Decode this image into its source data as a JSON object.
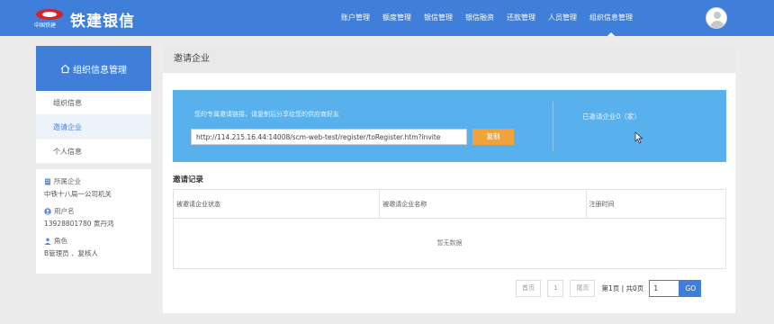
{
  "header": {
    "logo_sub": "中国铁建",
    "brand": "铁建银信",
    "nav": [
      {
        "label": "账户管理"
      },
      {
        "label": "额度管理"
      },
      {
        "label": "银信管理"
      },
      {
        "label": "银信融资"
      },
      {
        "label": "还款管理"
      },
      {
        "label": "人员管理"
      },
      {
        "label": "组织信息管理"
      }
    ]
  },
  "sidebar": {
    "title": "组织信息管理",
    "items": [
      {
        "label": "组织信息"
      },
      {
        "label": "邀请企业"
      },
      {
        "label": "个人信息"
      }
    ],
    "info": {
      "company_label": "所属企业",
      "company_value": "中铁十八局一公司机关",
      "user_label": "用户名",
      "user_value": "13928801780 黄丹鸿",
      "role_label": "角色",
      "role_value": "B管理员 、复核人"
    }
  },
  "main": {
    "title": "邀请企业",
    "banner": {
      "text": "您的专属邀请链接，请复制后分享给您的供应商好友",
      "link": "http://114.215.16.44:14008/scm-web-test/register/toRegister.htm?invite",
      "copy_label": "复制",
      "invited_count": "已邀请企业0（家）"
    },
    "records_title": "邀请记录",
    "table": {
      "columns": [
        "被邀请企业状态",
        "被邀请企业名称",
        "注册时间"
      ],
      "empty_text": "暂无数据"
    },
    "pager": {
      "first": "首页",
      "page": "1",
      "last": "尾页",
      "info": "第1页 | 共0页",
      "input_value": "1",
      "go": "GO"
    }
  },
  "colors": {
    "header_bg": "#3f7fd9",
    "banner_bg": "#58b0ed",
    "copy_btn": "#f0a33a"
  }
}
